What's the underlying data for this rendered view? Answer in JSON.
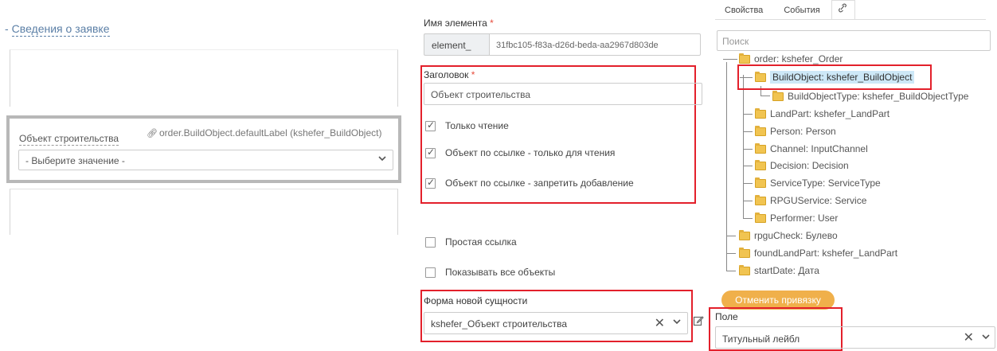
{
  "left": {
    "section_title": "Сведения о заявке",
    "field_label": "Объект строительства",
    "binding_path": "order.BuildObject.defaultLabel (kshefer_BuildObject)",
    "select_value": "- Выберите значение -"
  },
  "middle": {
    "element_name_label": "Имя элемента",
    "required_mark": "*",
    "element_prefix": "element_",
    "element_value": "31fbc105-f83a-d26d-beda-aa2967d803de",
    "title_label": "Заголовок",
    "title_value": "Объект строительства",
    "checkboxes": [
      {
        "label": "Только чтение",
        "checked": true
      },
      {
        "label": "Объект по ссылке - только для чтения",
        "checked": true
      },
      {
        "label": "Объект по ссылке - запретить добавление",
        "checked": true
      },
      {
        "label": "Простая ссылка",
        "checked": false
      },
      {
        "label": "Показывать все объекты",
        "checked": false
      }
    ],
    "new_entity_form_label": "Форма новой сущности",
    "new_entity_form_value": "kshefer_Объект строительства",
    "clear_symbol": "✕",
    "chevron_symbol": "⌄"
  },
  "right": {
    "tabs": [
      "Свойства",
      "События"
    ],
    "link_tab_icon": "link-icon",
    "search_placeholder": "Поиск",
    "tree": [
      {
        "label": "order: kshefer_Order",
        "level": 0
      },
      {
        "label": "BuildObject: kshefer_BuildObject",
        "level": 1,
        "selected": true
      },
      {
        "label": "BuildObjectType: kshefer_BuildObjectType",
        "level": 2
      },
      {
        "label": "LandPart: kshefer_LandPart",
        "level": 1
      },
      {
        "label": "Person: Person",
        "level": 1
      },
      {
        "label": "Channel: InputChannel",
        "level": 1
      },
      {
        "label": "Decision: Decision",
        "level": 1
      },
      {
        "label": "ServiceType: ServiceType",
        "level": 1
      },
      {
        "label": "RPGUService: Service",
        "level": 1
      },
      {
        "label": "Performer: User",
        "level": 1
      },
      {
        "label": "rpguCheck: Булево",
        "level": 0
      },
      {
        "label": "foundLandPart: kshefer_LandPart",
        "level": 0
      },
      {
        "label": "startDate: Дата",
        "level": 0
      }
    ],
    "unbind_button": "Отменить привязку",
    "field_label": "Поле",
    "field_value": "Титульный лейбл"
  },
  "colors": {
    "highlight_red": "#e3202b",
    "accent_orange": "#f0b04b",
    "selection_blue": "#cde8f7",
    "folder_yellow": "#f1c451",
    "section_blue": "#5b7fa6"
  }
}
